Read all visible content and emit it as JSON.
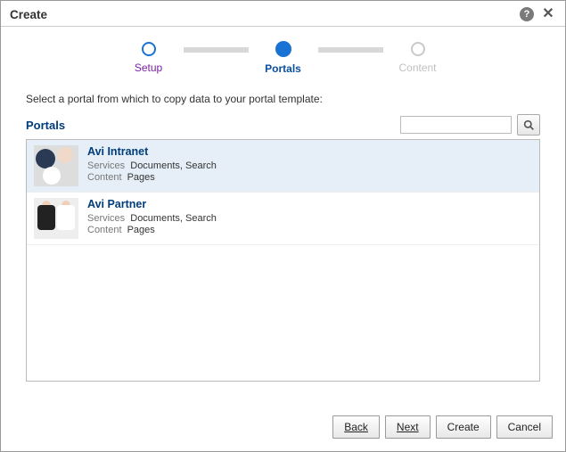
{
  "dialog": {
    "title": "Create"
  },
  "steps": {
    "setup": "Setup",
    "portals": "Portals",
    "content": "Content"
  },
  "instruction": "Select a portal from which to copy data to your portal template:",
  "portals": {
    "heading": "Portals",
    "search_placeholder": "",
    "items": [
      {
        "name": "Avi Intranet",
        "services_label": "Services",
        "services": "Documents, Search",
        "content_label": "Content",
        "content": "Pages"
      },
      {
        "name": "Avi Partner",
        "services_label": "Services",
        "services": "Documents, Search",
        "content_label": "Content",
        "content": "Pages"
      }
    ]
  },
  "buttons": {
    "back": "Back",
    "next": "Next",
    "create": "Create",
    "cancel": "Cancel"
  }
}
